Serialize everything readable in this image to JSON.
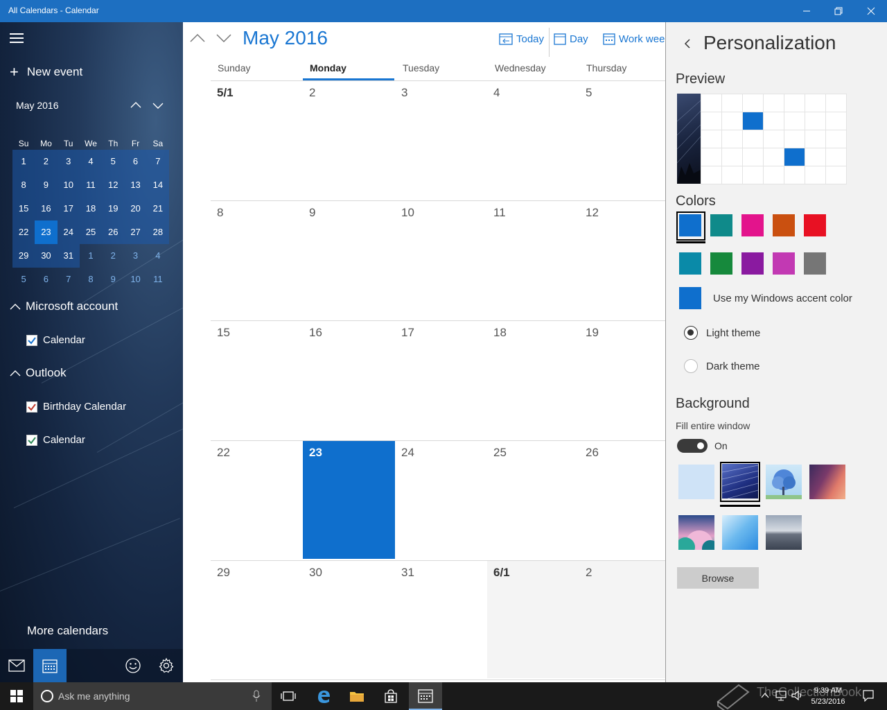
{
  "window": {
    "title": "All Calendars - Calendar"
  },
  "sidebar": {
    "new_event": "New event",
    "mini_calendar": {
      "month_label": "May 2016",
      "weekdays": [
        "Su",
        "Mo",
        "Tu",
        "We",
        "Th",
        "Fr",
        "Sa"
      ],
      "weeks": [
        [
          "1",
          "2",
          "3",
          "4",
          "5",
          "6",
          "7"
        ],
        [
          "8",
          "9",
          "10",
          "11",
          "12",
          "13",
          "14"
        ],
        [
          "15",
          "16",
          "17",
          "18",
          "19",
          "20",
          "21"
        ],
        [
          "22",
          "23",
          "24",
          "25",
          "26",
          "27",
          "28"
        ],
        [
          "29",
          "30",
          "31",
          "1",
          "2",
          "3",
          "4"
        ],
        [
          "5",
          "6",
          "7",
          "8",
          "9",
          "10",
          "11"
        ]
      ],
      "today": "23"
    },
    "groups": [
      {
        "name": "Microsoft account",
        "calendars": [
          {
            "label": "Calendar",
            "color": "#1976d2",
            "checked": true
          }
        ]
      },
      {
        "name": "Outlook",
        "calendars": [
          {
            "label": "Birthday Calendar",
            "color": "#c1392b",
            "checked": true
          },
          {
            "label": "Calendar",
            "color": "#2e8b57",
            "checked": true
          }
        ]
      }
    ],
    "more_calendars": "More calendars",
    "bottom_icons": [
      "mail-icon",
      "calendar-icon",
      "smiley-icon",
      "gear-icon"
    ]
  },
  "main": {
    "month_title": "May 2016",
    "views": {
      "today": "Today",
      "day": "Day",
      "work_week": "Work week"
    },
    "day_headers": [
      "Sunday",
      "Monday",
      "Tuesday",
      "Wednesday",
      "Thursday"
    ],
    "selected_day_header": "Monday",
    "weeks": [
      [
        "5/1",
        "2",
        "3",
        "4",
        "5"
      ],
      [
        "8",
        "9",
        "10",
        "11",
        "12"
      ],
      [
        "15",
        "16",
        "17",
        "18",
        "19"
      ],
      [
        "22",
        "23",
        "24",
        "25",
        "26"
      ],
      [
        "29",
        "30",
        "31",
        "6/1",
        "2"
      ]
    ],
    "today_label": "23"
  },
  "personalization": {
    "title": "Personalization",
    "preview_heading": "Preview",
    "colors_heading": "Colors",
    "colors": [
      "#0f6fcd",
      "#0f8a8a",
      "#e3148c",
      "#ca5010",
      "#e81123",
      "#0a8aa8",
      "#16893c",
      "#8a1aa0",
      "#c239b3",
      "#767676"
    ],
    "selected_color": "#0f6fcd",
    "accent_label": "Use my Windows accent color",
    "accent_color": "#0f6fcd",
    "light_theme": "Light theme",
    "dark_theme": "Dark theme",
    "selected_theme": "Light theme",
    "background_heading": "Background",
    "fill_label": "Fill entire window",
    "toggle_label": "On",
    "toggle_state": true,
    "browse_label": "Browse"
  },
  "taskbar": {
    "search_placeholder": "Ask me anything",
    "time": "9:39 AM",
    "date": "5/23/2016",
    "watermark": "TheCollectionBook"
  }
}
